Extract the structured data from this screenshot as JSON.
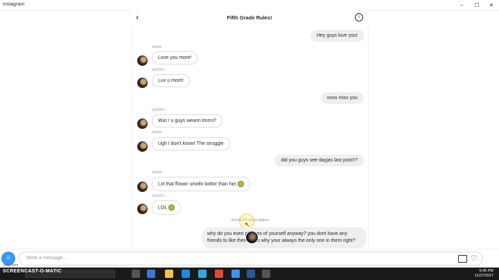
{
  "window": {
    "app_name": "Instagram",
    "minimize": "–",
    "maximize": "☐",
    "close": "✕"
  },
  "header": {
    "back": "‹",
    "title": "Fifth Grade Rules!",
    "info": "i"
  },
  "messages": [
    {
      "text": "Hey guys love you!"
    },
    {
      "sender": "ahlwei",
      "text": "Love you more!"
    },
    {
      "sender": "lyle0201",
      "text": "Luv u more!"
    },
    {
      "text": "xoxo miss you"
    },
    {
      "sender": "lyle0201",
      "text": "Wut r u guys wearin tmrro?"
    },
    {
      "sender": "ahlwei",
      "text": "Ugh I don't know! The struggle"
    },
    {
      "text": "did you guys see dayjas last post!!?"
    },
    {
      "sender": "ahlwei",
      "text": "Lol that flower smells better than her"
    },
    {
      "sender": "lyle0201",
      "text": "LOL"
    }
  ],
  "system_note": {
    "user": "kloc4h328",
    "action": "added",
    "target": "daijam"
  },
  "last_message": "why do you even pictures of yourself anyway? you dont have any friends to like them thats why your always the only one in them right?",
  "composer": {
    "placeholder": "Write a message..."
  },
  "taskbar": {
    "watermark": "SCREENCAST-O-MATIC",
    "watermark_top": "drag here",
    "time": "6:45 PM",
    "date": "11/27/2017"
  },
  "colors": {
    "accent": "#3897f0",
    "bubble_out": "#efefef",
    "taskbar": "#1a1a1a"
  }
}
